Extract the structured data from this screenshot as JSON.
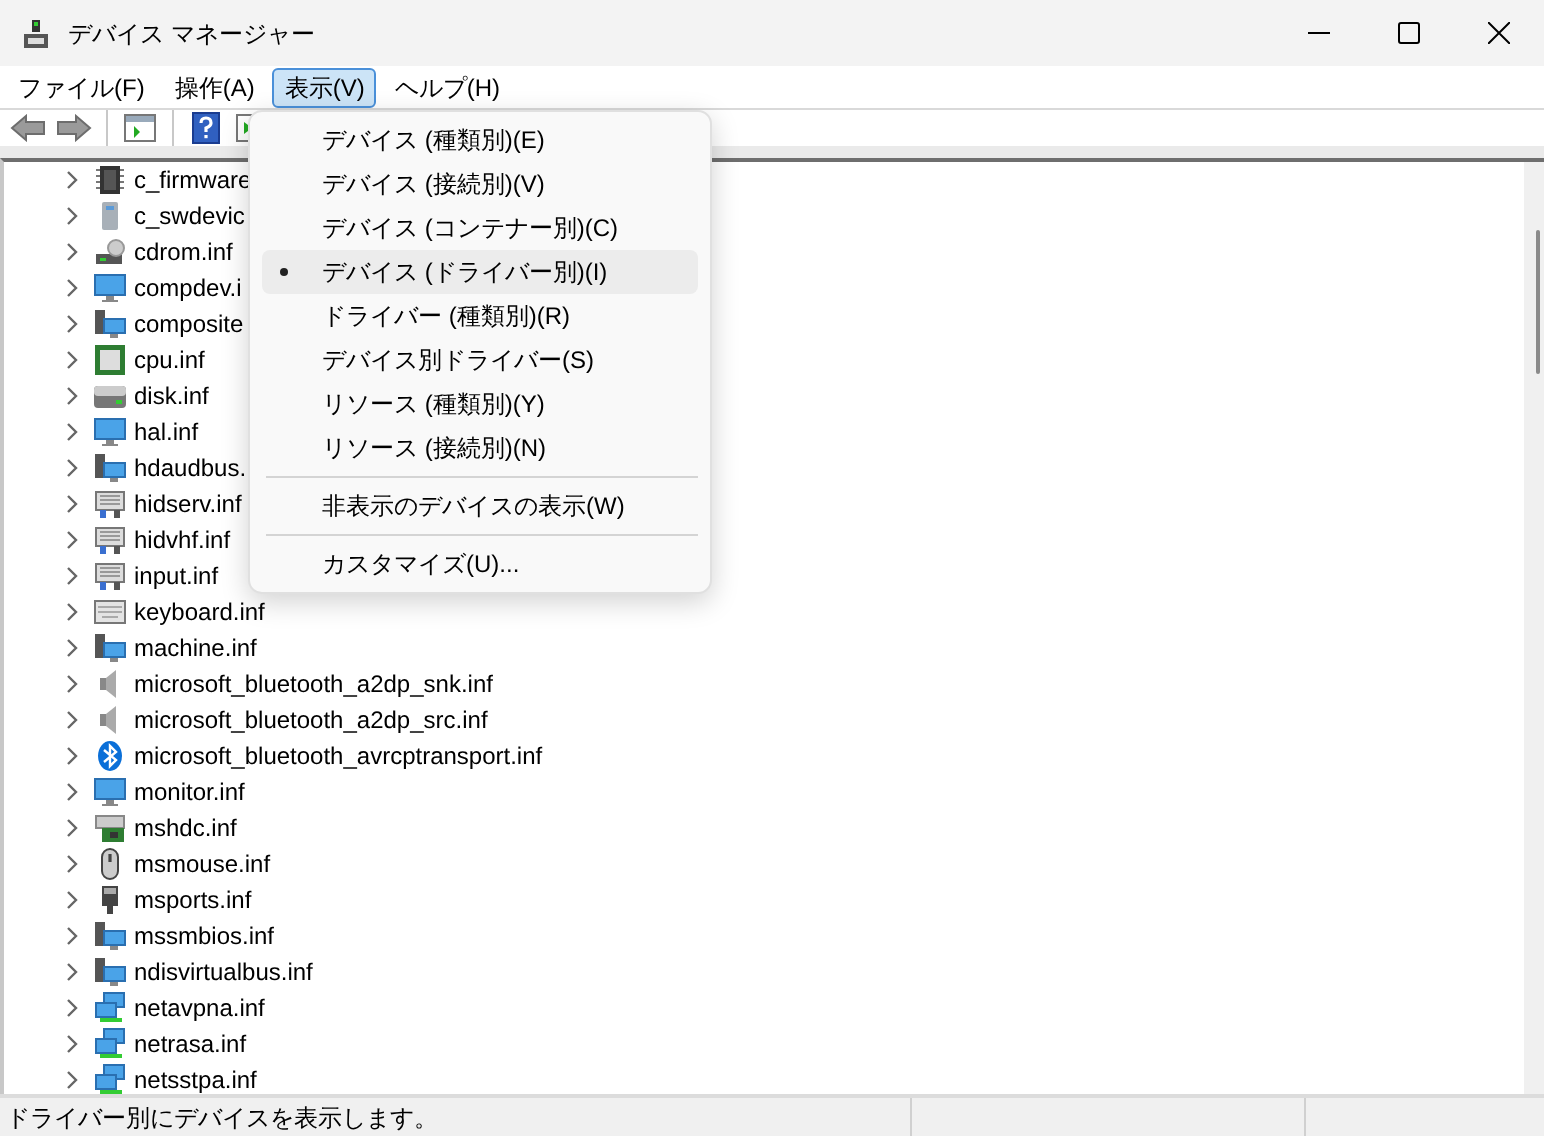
{
  "window": {
    "title": "デバイス マネージャー"
  },
  "menu_bar": [
    {
      "label": "ファイル(F)",
      "selected": false
    },
    {
      "label": "操作(A)",
      "selected": false
    },
    {
      "label": "表示(V)",
      "selected": true
    },
    {
      "label": "ヘルプ(H)",
      "selected": false
    }
  ],
  "view_menu": [
    {
      "kind": "item",
      "label": "デバイス (種類別)(E)",
      "checked": false,
      "highlighted": false
    },
    {
      "kind": "item",
      "label": "デバイス (接続別)(V)",
      "checked": false,
      "highlighted": false
    },
    {
      "kind": "item",
      "label": "デバイス (コンテナー別)(C)",
      "checked": false,
      "highlighted": false
    },
    {
      "kind": "item",
      "label": "デバイス (ドライバー別)(I)",
      "checked": true,
      "highlighted": true
    },
    {
      "kind": "item",
      "label": "ドライバー (種類別)(R)",
      "checked": false,
      "highlighted": false
    },
    {
      "kind": "item",
      "label": "デバイス別ドライバー(S)",
      "checked": false,
      "highlighted": false
    },
    {
      "kind": "item",
      "label": "リソース (種類別)(Y)",
      "checked": false,
      "highlighted": false
    },
    {
      "kind": "item",
      "label": "リソース (接続別)(N)",
      "checked": false,
      "highlighted": false
    },
    {
      "kind": "separator"
    },
    {
      "kind": "item",
      "label": "非表示のデバイスの表示(W)",
      "checked": false,
      "highlighted": false
    },
    {
      "kind": "separator"
    },
    {
      "kind": "item",
      "label": "カスタマイズ(U)...",
      "checked": false,
      "highlighted": false
    }
  ],
  "tree": [
    {
      "label": "c_firmware",
      "kind": "chip",
      "expanded": false
    },
    {
      "label": "c_swdevic",
      "kind": "tower",
      "expanded": false
    },
    {
      "label": "cdrom.inf",
      "kind": "cdrom",
      "expanded": false
    },
    {
      "label": "compdev.i",
      "kind": "monitor",
      "expanded": false
    },
    {
      "label": "composite",
      "kind": "computer",
      "expanded": false
    },
    {
      "label": "cpu.inf",
      "kind": "cpu",
      "expanded": false
    },
    {
      "label": "disk.inf",
      "kind": "disk",
      "expanded": false
    },
    {
      "label": "hal.inf",
      "kind": "monitor",
      "expanded": false
    },
    {
      "label": "hdaudbus.",
      "kind": "computer",
      "expanded": false
    },
    {
      "label": "hidserv.inf",
      "kind": "hid",
      "expanded": false
    },
    {
      "label": "hidvhf.inf",
      "kind": "hid",
      "expanded": false
    },
    {
      "label": "input.inf",
      "kind": "hid",
      "expanded": false
    },
    {
      "label": "keyboard.inf",
      "kind": "keyboard",
      "expanded": false
    },
    {
      "label": "machine.inf",
      "kind": "computer",
      "expanded": false
    },
    {
      "label": "microsoft_bluetooth_a2dp_snk.inf",
      "kind": "speaker",
      "expanded": false
    },
    {
      "label": "microsoft_bluetooth_a2dp_src.inf",
      "kind": "speaker",
      "expanded": false
    },
    {
      "label": "microsoft_bluetooth_avrcptransport.inf",
      "kind": "bluetooth",
      "expanded": false
    },
    {
      "label": "monitor.inf",
      "kind": "monitor",
      "expanded": false
    },
    {
      "label": "mshdc.inf",
      "kind": "controller",
      "expanded": false
    },
    {
      "label": "msmouse.inf",
      "kind": "mouse",
      "expanded": false
    },
    {
      "label": "msports.inf",
      "kind": "port",
      "expanded": false
    },
    {
      "label": "mssmbios.inf",
      "kind": "computer",
      "expanded": false
    },
    {
      "label": "ndisvirtualbus.inf",
      "kind": "computer",
      "expanded": false
    },
    {
      "label": "netavpna.inf",
      "kind": "network",
      "expanded": false
    },
    {
      "label": "netrasa.inf",
      "kind": "network",
      "expanded": false
    },
    {
      "label": "netsstpa.inf",
      "kind": "network",
      "expanded": false
    }
  ],
  "status_bar": {
    "text": "ドライバー別にデバイスを表示します。"
  }
}
